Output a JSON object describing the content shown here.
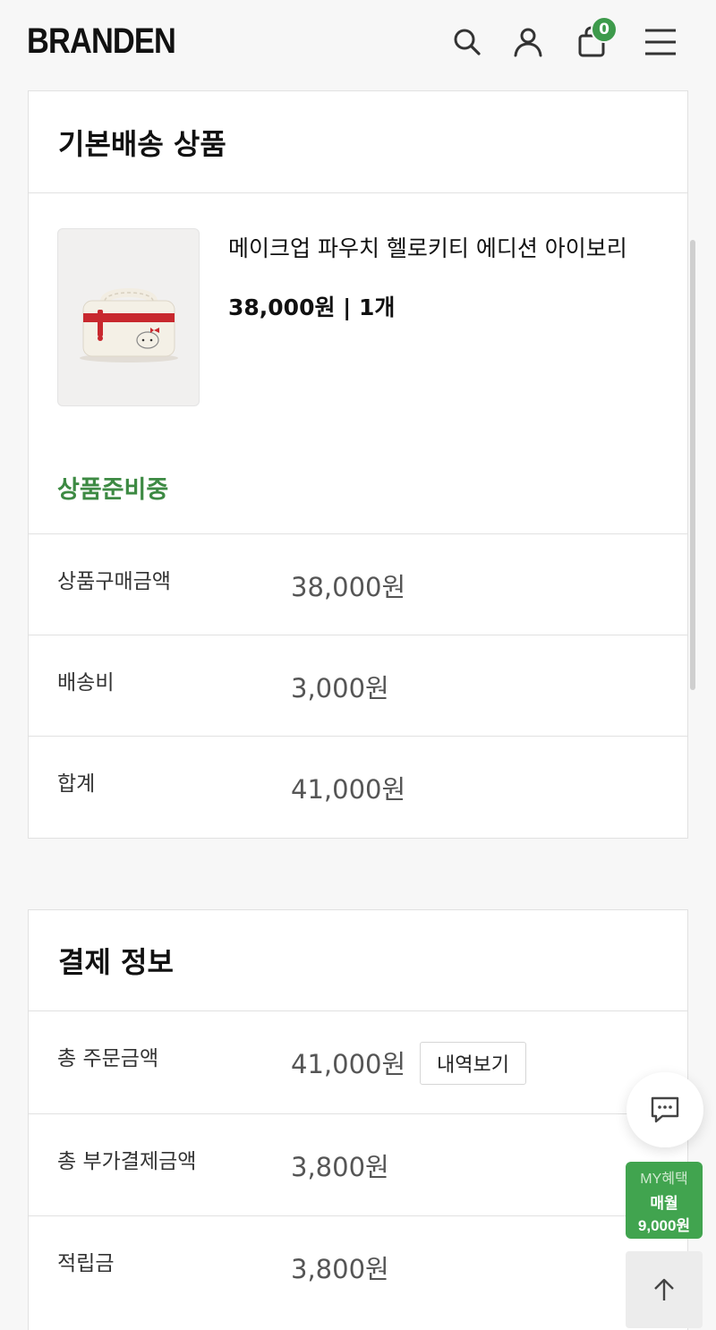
{
  "header": {
    "logo": "BRANDEN",
    "icons": [
      "search-icon",
      "user-icon",
      "bag-icon",
      "menu-icon"
    ],
    "cart_count": "0"
  },
  "shipping_card": {
    "title": "기본배송 상품",
    "product": {
      "name": "메이크업 파우치 헬로키티 에디션 아이보리",
      "price_qty": "38,000원 | 1개",
      "status": "상품준비중"
    },
    "rows": [
      {
        "label": "상품구매금액",
        "value": "38,000원"
      },
      {
        "label": "배송비",
        "value": "3,000원"
      },
      {
        "label": "합계",
        "value": "41,000원"
      }
    ]
  },
  "payment_card": {
    "title": "결제 정보",
    "rows": [
      {
        "label": "총 주문금액",
        "value": "41,000원",
        "button": "내역보기"
      },
      {
        "label": "총 부가결제금액",
        "value": "3,800원"
      },
      {
        "label": "적립금",
        "value": "3,800원"
      }
    ]
  },
  "floating": {
    "my_benefit_label": "MY혜택",
    "my_benefit_line1": "매월",
    "my_benefit_line2": "9,000원"
  },
  "colors": {
    "accent_green": "#3d9a4b",
    "status_green": "#3d8a43"
  }
}
